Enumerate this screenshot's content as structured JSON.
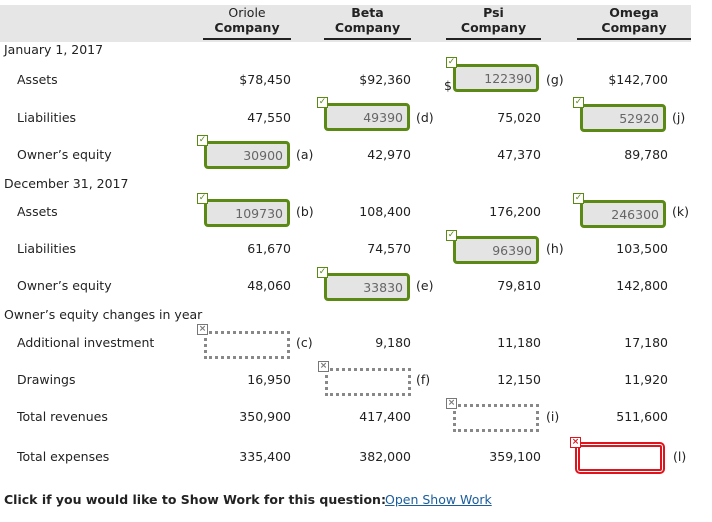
{
  "columns": [
    {
      "line1": "Oriole",
      "line2": "Company"
    },
    {
      "line1": "Beta",
      "line2": "Company"
    },
    {
      "line1": "Psi",
      "line2": "Company"
    },
    {
      "line1": "Omega",
      "line2": "Company"
    }
  ],
  "sections": {
    "jan": "January 1, 2017",
    "dec": "December 31, 2017",
    "changes": "Owner’s equity changes in year"
  },
  "labels": {
    "assets": "Assets",
    "liabilities": "Liabilities",
    "owners_equity": "Owner’s equity",
    "additional_investment": "Additional investment",
    "drawings": "Drawings",
    "total_revenues": "Total revenues",
    "total_expenses": "Total expenses"
  },
  "values": {
    "jan_assets": [
      "$78,450",
      "$92,360",
      "",
      "$142,700"
    ],
    "jan_liabilities": [
      "47,550",
      "",
      "75,020",
      ""
    ],
    "jan_equity": [
      "",
      "42,970",
      "47,370",
      "89,780"
    ],
    "dec_assets": [
      "",
      "108,400",
      "176,200",
      ""
    ],
    "dec_liabilities": [
      "61,670",
      "74,570",
      "",
      "103,500"
    ],
    "dec_equity": [
      "48,060",
      "",
      "79,810",
      "142,800"
    ],
    "additional_investment": [
      "",
      "9,180",
      "11,180",
      "17,180"
    ],
    "drawings": [
      "16,950",
      "",
      "12,150",
      "11,920"
    ],
    "total_revenues": [
      "350,900",
      "417,400",
      "",
      "511,600"
    ],
    "total_expenses": [
      "335,400",
      "382,000",
      "359,100",
      ""
    ]
  },
  "inputs": {
    "a": {
      "value": "30900",
      "tag": "(a)",
      "status": "correct"
    },
    "b": {
      "value": "109730",
      "tag": "(b)",
      "status": "correct"
    },
    "c": {
      "value": "",
      "tag": "(c)",
      "status": "incorrect"
    },
    "d": {
      "value": "49390",
      "tag": "(d)",
      "status": "correct"
    },
    "e": {
      "value": "33830",
      "tag": "(e)",
      "status": "correct"
    },
    "f": {
      "value": "",
      "tag": "(f)",
      "status": "incorrect"
    },
    "g": {
      "value": "122390",
      "tag": "(g)",
      "status": "correct",
      "prefix": "$"
    },
    "h": {
      "value": "96390",
      "tag": "(h)",
      "status": "correct"
    },
    "i": {
      "value": "",
      "tag": "(i)",
      "status": "incorrect"
    },
    "j": {
      "value": "52920",
      "tag": "(j)",
      "status": "correct"
    },
    "k": {
      "value": "246300",
      "tag": "(k)",
      "status": "correct"
    },
    "l": {
      "value": "",
      "tag": "(l)",
      "status": "incorrect-focused"
    }
  },
  "icons": {
    "correct": "✓",
    "incorrect": "×"
  },
  "footer": {
    "prompt": "Click if you would like to Show Work for this question:",
    "link": "Open Show Work"
  },
  "colors": {
    "correct": "#5a8a14",
    "incorrect": "#e0141c",
    "link": "#1a5d9c",
    "header_bg": "#e6e6e6"
  }
}
